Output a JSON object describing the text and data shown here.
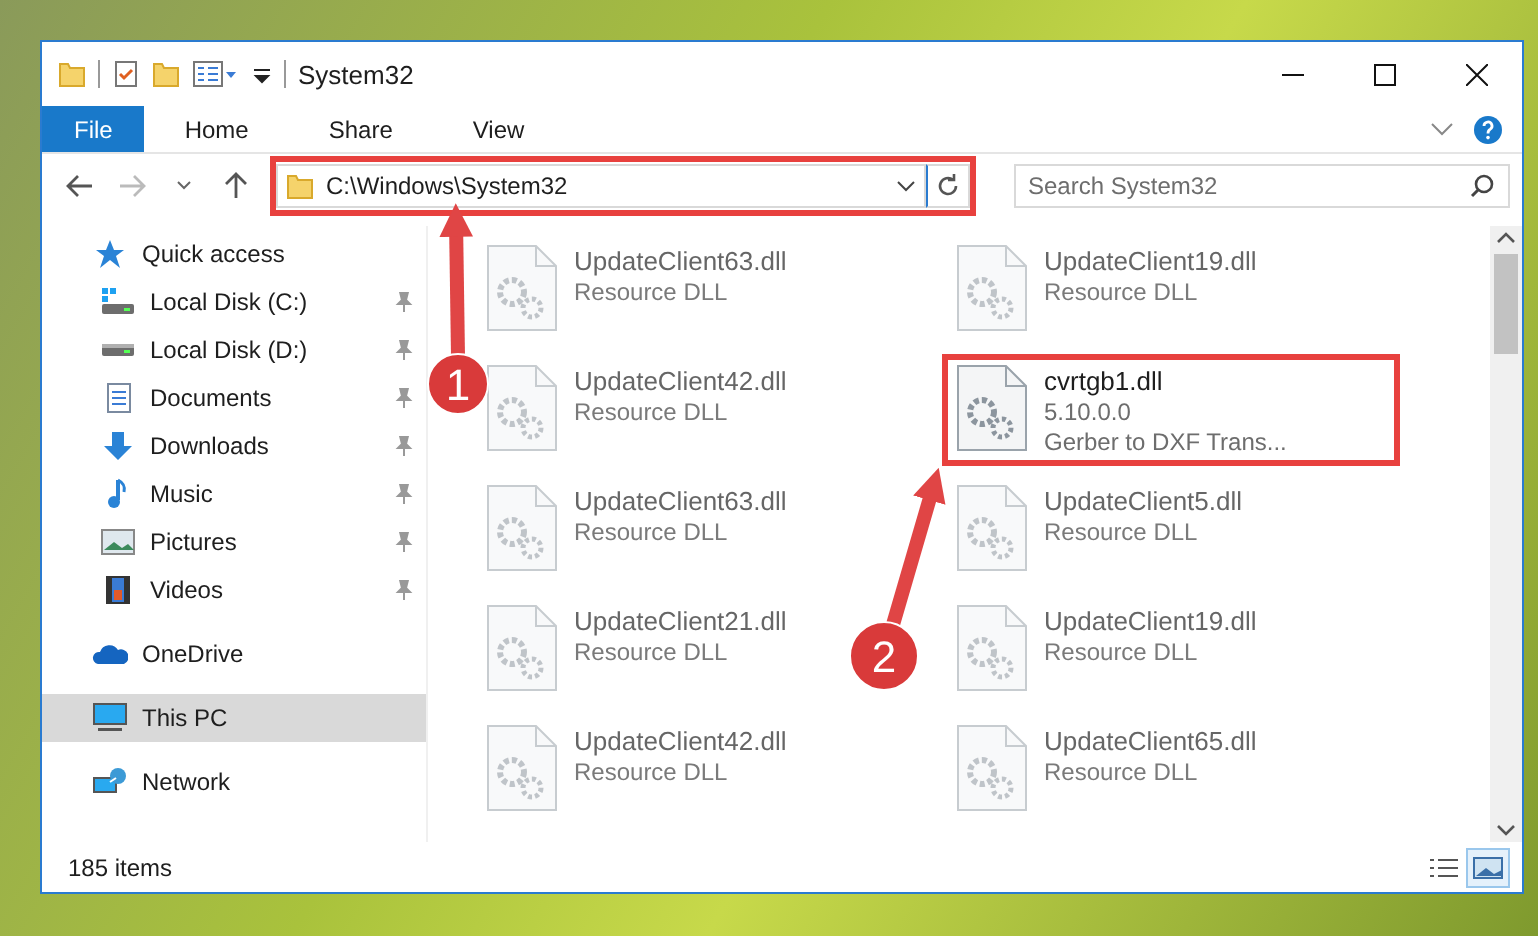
{
  "window": {
    "title": "System32"
  },
  "ribbon_tabs": [
    {
      "label": "File",
      "kind": "file",
      "selected": false
    },
    {
      "label": "Home",
      "kind": "tab",
      "selected": false
    },
    {
      "label": "Share",
      "kind": "tab",
      "selected": false
    },
    {
      "label": "View",
      "kind": "tab",
      "selected": false
    }
  ],
  "address_bar": {
    "path": "C:\\Windows\\System32",
    "highlighted": true
  },
  "search": {
    "placeholder": "Search System32"
  },
  "sidebar": {
    "items": [
      {
        "label": "Quick access",
        "kind": "star",
        "selected": false,
        "children": [
          {
            "label": "Local Disk (C:)",
            "kind": "system-drive",
            "pinned": true
          },
          {
            "label": "Local Disk (D:)",
            "kind": "drive",
            "pinned": true
          },
          {
            "label": "Documents",
            "kind": "documents",
            "pinned": true
          },
          {
            "label": "Downloads",
            "kind": "downloads",
            "pinned": true
          },
          {
            "label": "Music",
            "kind": "music",
            "pinned": true
          },
          {
            "label": "Pictures",
            "kind": "pictures",
            "pinned": true
          },
          {
            "label": "Videos",
            "kind": "videos",
            "pinned": true
          }
        ]
      },
      {
        "label": "OneDrive",
        "kind": "cloud",
        "selected": false
      },
      {
        "label": "This PC",
        "kind": "computer",
        "selected": true
      },
      {
        "label": "Network",
        "kind": "network",
        "selected": false
      }
    ]
  },
  "files": [
    {
      "name": "UpdateClient63.dll",
      "details": [
        "Resource DLL"
      ],
      "blurred": true,
      "highlighted": false
    },
    {
      "name": "UpdateClient19.dll",
      "details": [
        "Resource DLL"
      ],
      "blurred": true,
      "highlighted": false
    },
    {
      "name": "UpdateClient42.dll",
      "details": [
        "Resource DLL"
      ],
      "blurred": true,
      "highlighted": false
    },
    {
      "name": "cvrtgb1.dll",
      "details": [
        "5.10.0.0",
        "Gerber to DXF Trans..."
      ],
      "blurred": false,
      "highlighted": true
    },
    {
      "name": "UpdateClient63.dll",
      "details": [
        "Resource DLL"
      ],
      "blurred": true,
      "highlighted": false
    },
    {
      "name": "UpdateClient5.dll",
      "details": [
        "Resource DLL"
      ],
      "blurred": true,
      "highlighted": false
    },
    {
      "name": "UpdateClient21.dll",
      "details": [
        "Resource DLL"
      ],
      "blurred": true,
      "highlighted": false
    },
    {
      "name": "UpdateClient19.dll",
      "details": [
        "Resource DLL"
      ],
      "blurred": true,
      "highlighted": false
    },
    {
      "name": "UpdateClient42.dll",
      "details": [
        "Resource DLL"
      ],
      "blurred": true,
      "highlighted": false
    },
    {
      "name": "UpdateClient65.dll",
      "details": [
        "Resource DLL"
      ],
      "blurred": true,
      "highlighted": false
    }
  ],
  "status_bar": {
    "item_count": "185 items",
    "view_buttons": [
      {
        "kind": "details",
        "selected": false
      },
      {
        "kind": "large-icons",
        "selected": true
      }
    ]
  },
  "annotations": [
    {
      "number": "1"
    },
    {
      "number": "2"
    }
  ]
}
